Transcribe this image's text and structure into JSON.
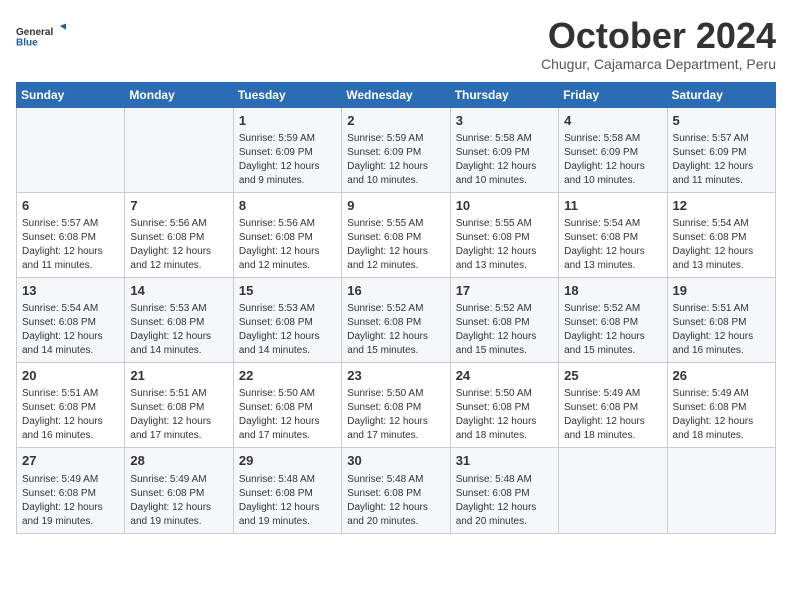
{
  "logo": {
    "line1": "General",
    "line2": "Blue"
  },
  "title": "October 2024",
  "location": "Chugur, Cajamarca Department, Peru",
  "weekdays": [
    "Sunday",
    "Monday",
    "Tuesday",
    "Wednesday",
    "Thursday",
    "Friday",
    "Saturday"
  ],
  "weeks": [
    [
      {
        "day": "",
        "info": ""
      },
      {
        "day": "",
        "info": ""
      },
      {
        "day": "1",
        "info": "Sunrise: 5:59 AM\nSunset: 6:09 PM\nDaylight: 12 hours and 9 minutes."
      },
      {
        "day": "2",
        "info": "Sunrise: 5:59 AM\nSunset: 6:09 PM\nDaylight: 12 hours and 10 minutes."
      },
      {
        "day": "3",
        "info": "Sunrise: 5:58 AM\nSunset: 6:09 PM\nDaylight: 12 hours and 10 minutes."
      },
      {
        "day": "4",
        "info": "Sunrise: 5:58 AM\nSunset: 6:09 PM\nDaylight: 12 hours and 10 minutes."
      },
      {
        "day": "5",
        "info": "Sunrise: 5:57 AM\nSunset: 6:09 PM\nDaylight: 12 hours and 11 minutes."
      }
    ],
    [
      {
        "day": "6",
        "info": "Sunrise: 5:57 AM\nSunset: 6:08 PM\nDaylight: 12 hours and 11 minutes."
      },
      {
        "day": "7",
        "info": "Sunrise: 5:56 AM\nSunset: 6:08 PM\nDaylight: 12 hours and 12 minutes."
      },
      {
        "day": "8",
        "info": "Sunrise: 5:56 AM\nSunset: 6:08 PM\nDaylight: 12 hours and 12 minutes."
      },
      {
        "day": "9",
        "info": "Sunrise: 5:55 AM\nSunset: 6:08 PM\nDaylight: 12 hours and 12 minutes."
      },
      {
        "day": "10",
        "info": "Sunrise: 5:55 AM\nSunset: 6:08 PM\nDaylight: 12 hours and 13 minutes."
      },
      {
        "day": "11",
        "info": "Sunrise: 5:54 AM\nSunset: 6:08 PM\nDaylight: 12 hours and 13 minutes."
      },
      {
        "day": "12",
        "info": "Sunrise: 5:54 AM\nSunset: 6:08 PM\nDaylight: 12 hours and 13 minutes."
      }
    ],
    [
      {
        "day": "13",
        "info": "Sunrise: 5:54 AM\nSunset: 6:08 PM\nDaylight: 12 hours and 14 minutes."
      },
      {
        "day": "14",
        "info": "Sunrise: 5:53 AM\nSunset: 6:08 PM\nDaylight: 12 hours and 14 minutes."
      },
      {
        "day": "15",
        "info": "Sunrise: 5:53 AM\nSunset: 6:08 PM\nDaylight: 12 hours and 14 minutes."
      },
      {
        "day": "16",
        "info": "Sunrise: 5:52 AM\nSunset: 6:08 PM\nDaylight: 12 hours and 15 minutes."
      },
      {
        "day": "17",
        "info": "Sunrise: 5:52 AM\nSunset: 6:08 PM\nDaylight: 12 hours and 15 minutes."
      },
      {
        "day": "18",
        "info": "Sunrise: 5:52 AM\nSunset: 6:08 PM\nDaylight: 12 hours and 15 minutes."
      },
      {
        "day": "19",
        "info": "Sunrise: 5:51 AM\nSunset: 6:08 PM\nDaylight: 12 hours and 16 minutes."
      }
    ],
    [
      {
        "day": "20",
        "info": "Sunrise: 5:51 AM\nSunset: 6:08 PM\nDaylight: 12 hours and 16 minutes."
      },
      {
        "day": "21",
        "info": "Sunrise: 5:51 AM\nSunset: 6:08 PM\nDaylight: 12 hours and 17 minutes."
      },
      {
        "day": "22",
        "info": "Sunrise: 5:50 AM\nSunset: 6:08 PM\nDaylight: 12 hours and 17 minutes."
      },
      {
        "day": "23",
        "info": "Sunrise: 5:50 AM\nSunset: 6:08 PM\nDaylight: 12 hours and 17 minutes."
      },
      {
        "day": "24",
        "info": "Sunrise: 5:50 AM\nSunset: 6:08 PM\nDaylight: 12 hours and 18 minutes."
      },
      {
        "day": "25",
        "info": "Sunrise: 5:49 AM\nSunset: 6:08 PM\nDaylight: 12 hours and 18 minutes."
      },
      {
        "day": "26",
        "info": "Sunrise: 5:49 AM\nSunset: 6:08 PM\nDaylight: 12 hours and 18 minutes."
      }
    ],
    [
      {
        "day": "27",
        "info": "Sunrise: 5:49 AM\nSunset: 6:08 PM\nDaylight: 12 hours and 19 minutes."
      },
      {
        "day": "28",
        "info": "Sunrise: 5:49 AM\nSunset: 6:08 PM\nDaylight: 12 hours and 19 minutes."
      },
      {
        "day": "29",
        "info": "Sunrise: 5:48 AM\nSunset: 6:08 PM\nDaylight: 12 hours and 19 minutes."
      },
      {
        "day": "30",
        "info": "Sunrise: 5:48 AM\nSunset: 6:08 PM\nDaylight: 12 hours and 20 minutes."
      },
      {
        "day": "31",
        "info": "Sunrise: 5:48 AM\nSunset: 6:08 PM\nDaylight: 12 hours and 20 minutes."
      },
      {
        "day": "",
        "info": ""
      },
      {
        "day": "",
        "info": ""
      }
    ]
  ]
}
